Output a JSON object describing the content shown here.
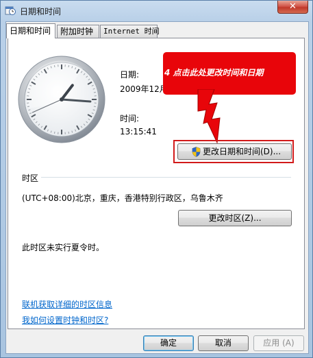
{
  "window": {
    "title": "日期和时间",
    "close_label": "✕"
  },
  "tabs": [
    {
      "label": "日期和时间"
    },
    {
      "label": "附加时钟"
    },
    {
      "label": "Internet 时间"
    }
  ],
  "date_section": {
    "date_label": "日期:",
    "date_value": "2009年12月",
    "time_label": "时间:",
    "time_value": "13:15:41"
  },
  "change_datetime_button": "更改日期和时间(D)...",
  "annotation": {
    "text": "4 点击此处更改时间和日期"
  },
  "timezone": {
    "header": "时区",
    "value": "(UTC+08:00)北京，重庆，香港特别行政区，乌鲁木齐",
    "change_button": "更改时区(Z)...",
    "dst_note": "此时区未实行夏令时。"
  },
  "links": {
    "online_info": "联机获取详细的时区信息",
    "how_to_set": "我如何设置时钟和时区?"
  },
  "footer": {
    "ok": "确定",
    "cancel": "取消",
    "apply": "应用 (A)"
  },
  "clock": {
    "hour": 1,
    "minute": 15,
    "second": 41
  },
  "colors": {
    "annotation_red": "#e8050a",
    "link_blue": "#0066cc"
  }
}
